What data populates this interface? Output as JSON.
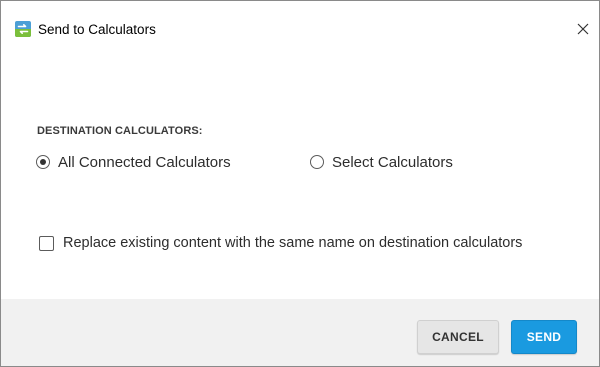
{
  "window": {
    "title": "Send to Calculators",
    "app_icon": "calculator-transfer-icon",
    "close_icon": "close-icon"
  },
  "destination": {
    "section_label": "DESTINATION CALCULATORS:",
    "options": [
      {
        "label": "All Connected Calculators",
        "checked": true
      },
      {
        "label": "Select Calculators",
        "checked": false
      }
    ]
  },
  "replace_option": {
    "label": "Replace existing content with the same name on destination calculators",
    "checked": false
  },
  "footer": {
    "cancel_label": "CANCEL",
    "send_label": "SEND"
  },
  "colors": {
    "accent": "#1a9ae0",
    "footer_bg": "#f1f1f1"
  }
}
